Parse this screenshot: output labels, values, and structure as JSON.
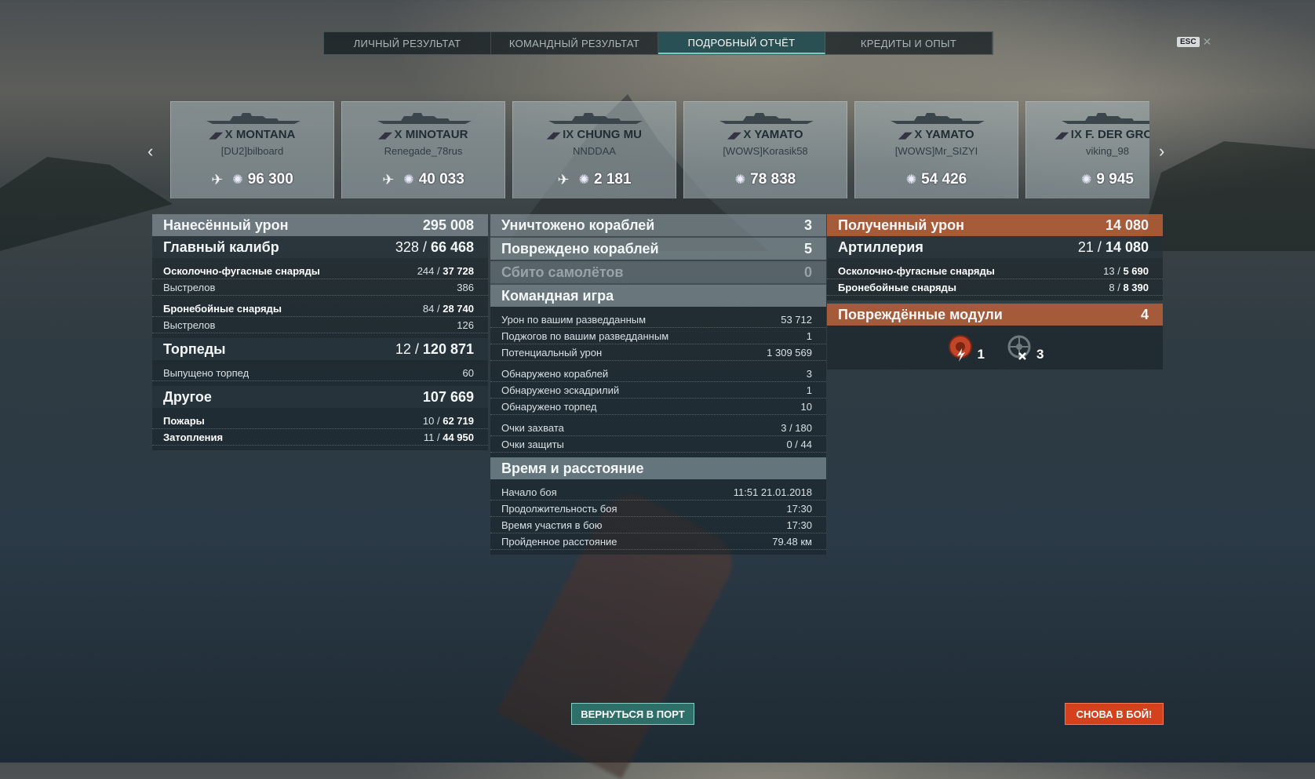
{
  "tabs": [
    "ЛИЧНЫЙ РЕЗУЛЬТАТ",
    "КОМАНДНЫЙ РЕЗУЛЬТАТ",
    "ПОДРОБНЫЙ ОТЧЁТ",
    "КРЕДИТЫ И ОПЫТ"
  ],
  "active_tab": "ПОДРОБНЫЙ ОТЧЁТ",
  "esc_label": "ESC",
  "cards": [
    {
      "tier": "X",
      "ship": "MONTANA",
      "player": "[DU2]bilboard",
      "damage": "96 300",
      "plane": true
    },
    {
      "tier": "X",
      "ship": "MINOTAUR",
      "player": "Renegade_78rus",
      "damage": "40 033",
      "plane": true
    },
    {
      "tier": "IX",
      "ship": "CHUNG MU",
      "player": "NNDDAA",
      "damage": "2 181",
      "plane": true
    },
    {
      "tier": "X",
      "ship": "YAMATO",
      "player": "[WOWS]Korasik58",
      "damage": "78 838",
      "plane": false
    },
    {
      "tier": "X",
      "ship": "YAMATO",
      "player": "[WOWS]Mr_SIZYI",
      "damage": "54 426",
      "plane": false
    },
    {
      "tier": "IX",
      "ship": "F. DER GROß",
      "player": "viking_98",
      "damage": "9 945",
      "plane": false
    }
  ],
  "left": {
    "dealt": {
      "label": "Нанесённый урон",
      "value": "295 008"
    },
    "main": {
      "label": "Главный калибр",
      "hits": "328",
      "value": "66 468"
    },
    "he": {
      "label": "Осколочно-фугасные снаряды",
      "hits": "244",
      "value": "37 728"
    },
    "he_shots": {
      "label": "Выстрелов",
      "value": "386"
    },
    "ap": {
      "label": "Бронебойные снаряды",
      "hits": "84",
      "value": "28 740"
    },
    "ap_shots": {
      "label": "Выстрелов",
      "value": "126"
    },
    "torps": {
      "label": "Торпеды",
      "hits": "12",
      "value": "120 871"
    },
    "torps_fired": {
      "label": "Выпущено торпед",
      "value": "60"
    },
    "other": {
      "label": "Другое",
      "value": "107 669"
    },
    "fires": {
      "label": "Пожары",
      "hits": "10",
      "value": "62 719"
    },
    "floods": {
      "label": "Затопления",
      "hits": "11",
      "value": "44 950"
    }
  },
  "middle": {
    "destroyed": {
      "label": "Уничтожено кораблей",
      "value": "3"
    },
    "damaged": {
      "label": "Повреждено кораблей",
      "value": "5"
    },
    "planes": {
      "label": "Сбито самолётов",
      "value": "0"
    },
    "team": {
      "label": "Командная игра"
    },
    "team_rows": [
      {
        "label": "Урон по вашим разведданным",
        "value": "53 712"
      },
      {
        "label": "Поджогов по вашим разведданным",
        "value": "1"
      },
      {
        "label": "Потенциальный урон",
        "value": "1 309 569"
      },
      {
        "label": "Обнаружено кораблей",
        "value": "3"
      },
      {
        "label": "Обнаружено эскадрилий",
        "value": "1"
      },
      {
        "label": "Обнаружено торпед",
        "value": "10"
      },
      {
        "label": "Очки захвата",
        "value": "3 / 180"
      },
      {
        "label": "Очки защиты",
        "value": "0 / 44"
      }
    ],
    "time": {
      "label": "Время и расстояние"
    },
    "time_rows": [
      {
        "label": "Начало боя",
        "value": "11:51  21.01.2018"
      },
      {
        "label": "Продолжительность боя",
        "value": "17:30"
      },
      {
        "label": "Время участия в бою",
        "value": "17:30"
      },
      {
        "label": "Пройденное расстояние",
        "value": "79.48 км"
      }
    ]
  },
  "right": {
    "received": {
      "label": "Полученный урон",
      "value": "14 080"
    },
    "artillery": {
      "label": "Артиллерия",
      "hits": "21",
      "value": "14 080"
    },
    "he": {
      "label": "Осколочно-фугасные снаряды",
      "hits": "13",
      "value": "5 690"
    },
    "ap": {
      "label": "Бронебойные снаряды",
      "hits": "8",
      "value": "8 390"
    },
    "modules": {
      "label": "Повреждённые модули",
      "value": "4"
    },
    "module_counts": [
      {
        "icon": "engine-damage-icon",
        "count": "1"
      },
      {
        "icon": "steering-damage-icon",
        "count": "3"
      }
    ]
  },
  "buttons": {
    "port": "ВЕРНУТЬСЯ В ПОРТ",
    "battle": "СНОВА В БОЙ!"
  },
  "colors": {
    "accent_teal": "#2f6f6a",
    "accent_orange": "#ba5f37",
    "battle_button": "#d4411c"
  }
}
